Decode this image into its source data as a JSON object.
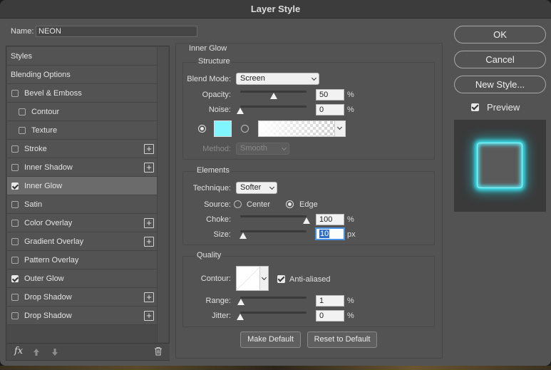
{
  "window": {
    "title": "Layer Style"
  },
  "name_field": {
    "label": "Name:",
    "value": "NEON"
  },
  "styles": {
    "items": [
      {
        "label": "Styles",
        "type": "header",
        "checked": false,
        "has_plus": false,
        "selected": false
      },
      {
        "label": "Blending Options",
        "type": "header",
        "checked": false,
        "has_plus": false,
        "selected": false
      },
      {
        "label": "Bevel & Emboss",
        "type": "effect",
        "checked": false,
        "has_plus": false,
        "selected": false
      },
      {
        "label": "Contour",
        "type": "sub",
        "checked": false,
        "has_plus": false,
        "selected": false
      },
      {
        "label": "Texture",
        "type": "sub",
        "checked": false,
        "has_plus": false,
        "selected": false
      },
      {
        "label": "Stroke",
        "type": "effect",
        "checked": false,
        "has_plus": true,
        "selected": false
      },
      {
        "label": "Inner Shadow",
        "type": "effect",
        "checked": false,
        "has_plus": true,
        "selected": false
      },
      {
        "label": "Inner Glow",
        "type": "effect",
        "checked": true,
        "has_plus": false,
        "selected": true
      },
      {
        "label": "Satin",
        "type": "effect",
        "checked": false,
        "has_plus": false,
        "selected": false
      },
      {
        "label": "Color Overlay",
        "type": "effect",
        "checked": false,
        "has_plus": true,
        "selected": false
      },
      {
        "label": "Gradient Overlay",
        "type": "effect",
        "checked": false,
        "has_plus": true,
        "selected": false
      },
      {
        "label": "Pattern Overlay",
        "type": "effect",
        "checked": false,
        "has_plus": false,
        "selected": false
      },
      {
        "label": "Outer Glow",
        "type": "effect",
        "checked": true,
        "has_plus": false,
        "selected": false
      },
      {
        "label": "Drop Shadow",
        "type": "effect",
        "checked": false,
        "has_plus": true,
        "selected": false
      },
      {
        "label": "Drop Shadow",
        "type": "effect",
        "checked": false,
        "has_plus": true,
        "selected": false
      }
    ],
    "footer_icons": [
      "fx-icon",
      "move-up-icon",
      "move-down-icon",
      "trash-icon"
    ]
  },
  "panel": {
    "title": "Inner Glow",
    "structure": {
      "title": "Structure",
      "blend_mode": {
        "label": "Blend Mode:",
        "value": "Screen"
      },
      "opacity": {
        "label": "Opacity:",
        "value": "50",
        "unit": "%",
        "level": 0.5
      },
      "noise": {
        "label": "Noise:",
        "value": "0",
        "unit": "%",
        "level": 0
      },
      "color_swatch": "#80f5ff",
      "method": {
        "label": "Method:",
        "value": "Smooth"
      }
    },
    "elements": {
      "title": "Elements",
      "technique": {
        "label": "Technique:",
        "value": "Softer"
      },
      "source": {
        "label": "Source:",
        "option_center": "Center",
        "option_edge": "Edge",
        "selected": "Edge"
      },
      "choke": {
        "label": "Choke:",
        "value": "100",
        "unit": "%",
        "level": 1.0
      },
      "size": {
        "label": "Size:",
        "value": "10",
        "unit": "px",
        "level": 0.04
      }
    },
    "quality": {
      "title": "Quality",
      "contour": {
        "label": "Contour:"
      },
      "anti_aliased": {
        "label": "Anti-aliased",
        "checked": true
      },
      "range": {
        "label": "Range:",
        "value": "1",
        "unit": "%",
        "level": 0.01
      },
      "jitter": {
        "label": "Jitter:",
        "value": "0",
        "unit": "%",
        "level": 0
      }
    },
    "make_default": "Make Default",
    "reset_default": "Reset to Default"
  },
  "buttons": {
    "ok": "OK",
    "cancel": "Cancel",
    "new_style": "New Style..."
  },
  "preview": {
    "label": "Preview",
    "checked": true,
    "glow_color": "#3ee6f0"
  }
}
